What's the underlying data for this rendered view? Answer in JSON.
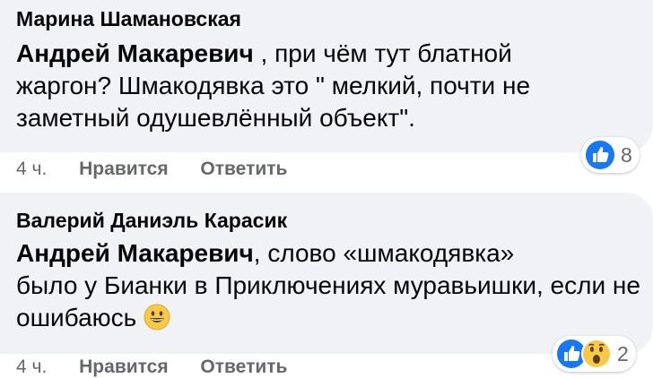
{
  "comments": [
    {
      "author": "Марина Шамановская",
      "mention": "Андрей Макаревич",
      "text_line1": " , при чём тут блатной",
      "text_rest": "жаргон? Шмакодявка это \" мелкий, почти не заметный одушевлённый объект\".",
      "time": "4 ч.",
      "like_label": "Нравится",
      "reply_label": "Ответить",
      "reaction_count": "8",
      "reaction_icons": [
        "like-icon"
      ]
    },
    {
      "author": "Валерий Даниэль Карасик",
      "mention": "Андрей Макаревич",
      "text_line1": ", слово «шмакодявка»",
      "text_rest": "было у Бианки в Приключениях муравьишки, если не ошибаюсь",
      "emoji": "grinning-face-emoji",
      "time": "4 ч.",
      "like_label": "Нравится",
      "reply_label": "Ответить",
      "reaction_count": "2",
      "reaction_icons": [
        "like-icon",
        "wow-icon"
      ]
    }
  ],
  "colors": {
    "bubble": "#f0f2f5",
    "text": "#050505",
    "secondary": "#65676b",
    "like_blue": "#1877f2"
  }
}
